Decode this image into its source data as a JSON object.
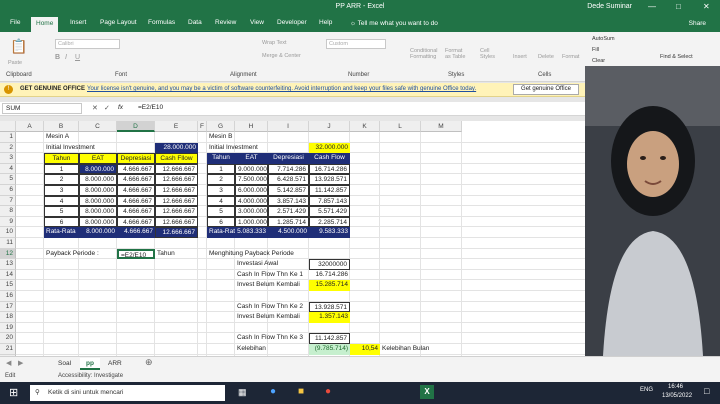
{
  "window": {
    "title": "PP ARR  -  Excel",
    "user": "Dede Suminar"
  },
  "tabs": [
    "File",
    "Home",
    "Insert",
    "Page Layout",
    "Formulas",
    "Data",
    "Review",
    "View",
    "Developer",
    "Help"
  ],
  "tellme": "Tell me what you want to do",
  "share": "Share",
  "ribbon": {
    "groups": [
      "Clipboard",
      "Font",
      "Alignment",
      "Number",
      "Styles",
      "Cells"
    ],
    "font_name": "Calibri",
    "number_format": "Custom",
    "items": [
      "Wrap Text",
      "Merge & Center",
      "Conditional Formatting",
      "Format as Table",
      "Cell Styles",
      "Insert",
      "Delete",
      "Format",
      "AutoSum",
      "Fill",
      "Clear",
      "Sort & Filter",
      "Find & Select",
      "Paste"
    ]
  },
  "message": {
    "heading": "GET GENUINE OFFICE",
    "text": "Your license isn't genuine, and you may be a victim of software counterfeiting. Avoid interruption and keep your files safe with genuine Office today.",
    "button": "Get genuine Office"
  },
  "formula_bar": {
    "name_box": "SUM",
    "fx": "fx",
    "formula": "=E2/E10"
  },
  "columns": [
    "A",
    "B",
    "C",
    "D",
    "E",
    "F",
    "G",
    "H",
    "I",
    "J",
    "K",
    "L",
    "M"
  ],
  "rows": [
    "1",
    "2",
    "3",
    "4",
    "5",
    "6",
    "7",
    "8",
    "9",
    "10",
    "11",
    "12",
    "13",
    "14",
    "15",
    "16",
    "17",
    "18",
    "19",
    "20",
    "21",
    "22"
  ],
  "mesinA": {
    "title": "Mesin A",
    "initial_label": "Initial Investment",
    "initial_value": "28.000.000",
    "headers": [
      "Tahun",
      "EAT",
      "Depresiasi",
      "Cash Fllow"
    ],
    "rows": [
      [
        "1",
        "8.000.000",
        "4.666.667",
        "12.666.667"
      ],
      [
        "2",
        "8.000.000",
        "4.666.667",
        "12.666.667"
      ],
      [
        "3",
        "8.000.000",
        "4.666.667",
        "12.666.667"
      ],
      [
        "4",
        "8.000.000",
        "4.666.667",
        "12.666.667"
      ],
      [
        "5",
        "8.000.000",
        "4.666.667",
        "12.666.667"
      ],
      [
        "6",
        "8.000.000",
        "4.666.667",
        "12.666.667"
      ]
    ],
    "total": [
      "Rata-Rata",
      "8.000.000",
      "4.666.667",
      "12.666.667"
    ],
    "payback_label": "Payback Periode :",
    "payback_formula": "=E2/E10",
    "payback_unit": "Tahun"
  },
  "mesinB": {
    "title": "Mesin B",
    "initial_label": "Initial Investment",
    "initial_value": "32.000.000",
    "headers": [
      "Tahun",
      "EAT",
      "Depresiasi",
      "Cash Flow"
    ],
    "rows": [
      [
        "1",
        "9.000.000",
        "7.714.286",
        "16.714.286"
      ],
      [
        "2",
        "7.500.000",
        "6.428.571",
        "13.928.571"
      ],
      [
        "3",
        "6.000.000",
        "5.142.857",
        "11.142.857"
      ],
      [
        "4",
        "4.000.000",
        "3.857.143",
        "7.857.143"
      ],
      [
        "5",
        "3.000.000",
        "2.571.429",
        "5.571.429"
      ],
      [
        "6",
        "1.000.000",
        "1.285.714",
        "2.285.714"
      ]
    ],
    "total": [
      "Rata-Rata",
      "5.083.333",
      "4.500.000",
      "9.583.333"
    ],
    "calc_title": "Menghitung Payback Periode",
    "investasi_label": "Investasi Awal",
    "investasi_value": "32000000",
    "cf1_label": "Cash In Flow Thn Ke 1",
    "cf1_value": "16.714.286",
    "ibk1_label": "Invest Belum Kembali",
    "ibk1_value": "15.285.714",
    "cf2_label": "Cash In Flow Thn Ke 2",
    "cf2_value": "13.928.571",
    "ibk2_label": "Invest Belum Kembali",
    "ibk2_value": "1.357.143",
    "cf3_label": "Cash In Flow Thn Ke 3",
    "cf3_value": "11.142.857",
    "kelebihan_label": "Kelebihan",
    "kelebihan_value": "(9.785.714)",
    "kelebihan_result": "10,54",
    "kelebihan_bulan": "Kelebihan Bulan"
  },
  "sheets": [
    "Soal",
    "pp",
    "ARR"
  ],
  "status": {
    "mode": "Edit",
    "accessibility": "Accessibility: Investigate"
  },
  "taskbar": {
    "search": "Ketik di sini untuk mencari",
    "lang": "ENG",
    "time": "16:46",
    "date": "13/05/2022"
  }
}
